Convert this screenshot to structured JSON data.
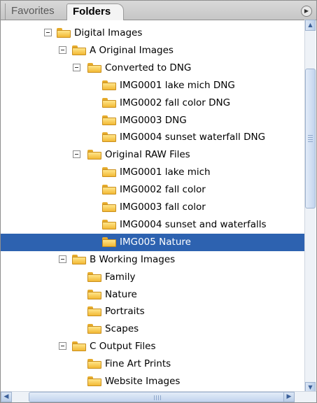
{
  "tabs": [
    {
      "label": "Favorites",
      "active": false
    },
    {
      "label": "Folders",
      "active": true
    }
  ],
  "tree": [
    {
      "label": "Digital Images",
      "depth": 0,
      "expandable": true,
      "selected": false
    },
    {
      "label": "A Original Images",
      "depth": 1,
      "expandable": true,
      "selected": false
    },
    {
      "label": "Converted to DNG",
      "depth": 2,
      "expandable": true,
      "selected": false
    },
    {
      "label": "IMG0001 lake mich DNG",
      "depth": 3,
      "expandable": false,
      "selected": false
    },
    {
      "label": "IMG0002 fall color DNG",
      "depth": 3,
      "expandable": false,
      "selected": false
    },
    {
      "label": "IMG0003 DNG",
      "depth": 3,
      "expandable": false,
      "selected": false
    },
    {
      "label": "IMG0004 sunset waterfall DNG",
      "depth": 3,
      "expandable": false,
      "selected": false
    },
    {
      "label": "Original RAW Files",
      "depth": 2,
      "expandable": true,
      "selected": false
    },
    {
      "label": "IMG0001 lake mich",
      "depth": 3,
      "expandable": false,
      "selected": false
    },
    {
      "label": "IMG0002 fall color",
      "depth": 3,
      "expandable": false,
      "selected": false
    },
    {
      "label": "IMG0003 fall color",
      "depth": 3,
      "expandable": false,
      "selected": false
    },
    {
      "label": "IMG0004 sunset and waterfalls",
      "depth": 3,
      "expandable": false,
      "selected": false
    },
    {
      "label": "IMG005 Nature",
      "depth": 3,
      "expandable": false,
      "selected": true
    },
    {
      "label": "B Working Images",
      "depth": 1,
      "expandable": true,
      "selected": false
    },
    {
      "label": "Family",
      "depth": 2,
      "expandable": false,
      "selected": false
    },
    {
      "label": "Nature",
      "depth": 2,
      "expandable": false,
      "selected": false
    },
    {
      "label": "Portraits",
      "depth": 2,
      "expandable": false,
      "selected": false
    },
    {
      "label": "Scapes",
      "depth": 2,
      "expandable": false,
      "selected": false
    },
    {
      "label": "C Output Files",
      "depth": 1,
      "expandable": true,
      "selected": false
    },
    {
      "label": "Fine Art Prints",
      "depth": 2,
      "expandable": false,
      "selected": false
    },
    {
      "label": "Website Images",
      "depth": 2,
      "expandable": false,
      "selected": false
    }
  ],
  "icons": {
    "folder": "folder-icon",
    "collapse": "collapse-minus-icon",
    "panel_menu": "panel-menu-icon",
    "scroll_up": "scroll-up-arrow-icon",
    "scroll_down": "scroll-down-arrow-icon",
    "scroll_left": "scroll-left-arrow-icon",
    "scroll_right": "scroll-right-arrow-icon"
  },
  "colors": {
    "selection": "#2d62b0",
    "folder": "#f2b935",
    "scrollbar": "#c2d4ee"
  }
}
